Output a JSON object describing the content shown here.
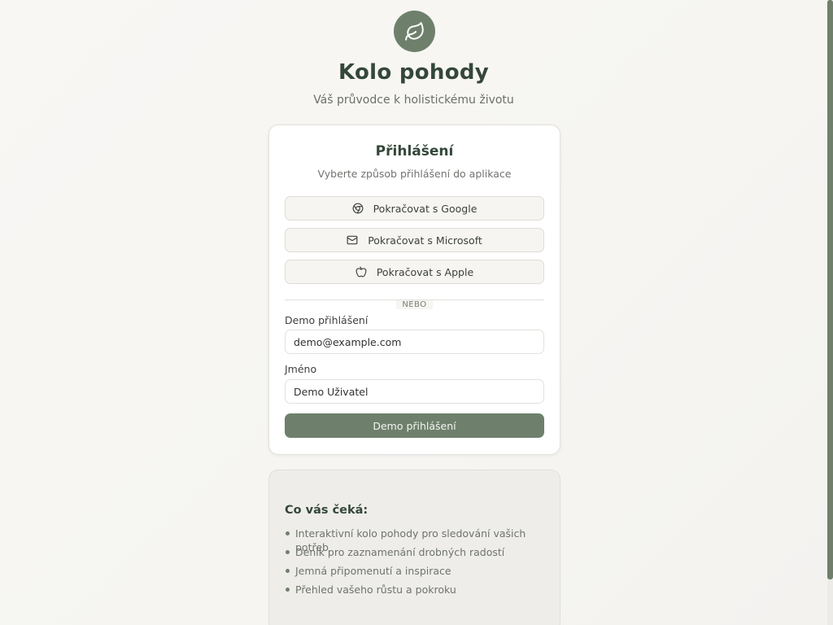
{
  "header": {
    "logo_icon": "leaf-icon",
    "title": "Kolo pohody",
    "subtitle": "Váš průvodce k holistickému životu"
  },
  "login": {
    "title": "Přihlášení",
    "subtitle": "Vyberte způsob přihlášení do aplikace",
    "providers": [
      {
        "label": "Pokračovat s Google",
        "icon": "chrome-icon"
      },
      {
        "label": "Pokračovat s Microsoft",
        "icon": "mail-icon"
      },
      {
        "label": "Pokračovat s Apple",
        "icon": "apple-icon"
      }
    ],
    "divider": "NEBO",
    "email_label": "Demo přihlášení",
    "email_value": "demo@example.com",
    "name_label": "Jméno",
    "name_value": "Demo Uživatel",
    "submit_label": "Demo přihlášení"
  },
  "features": {
    "title": "Co vás čeká:",
    "items": [
      "Interaktivní kolo pohody pro sledování vašich potřeb",
      "Deník pro zaznamenání drobných radostí",
      "Jemná připomenutí a inspirace",
      "Přehled vašeho růstu a pokroku"
    ]
  },
  "colors": {
    "accent": "#6e806c",
    "heading": "#34473a",
    "card_bg": "#ffffff",
    "page_bg": "#f8f7f4"
  }
}
